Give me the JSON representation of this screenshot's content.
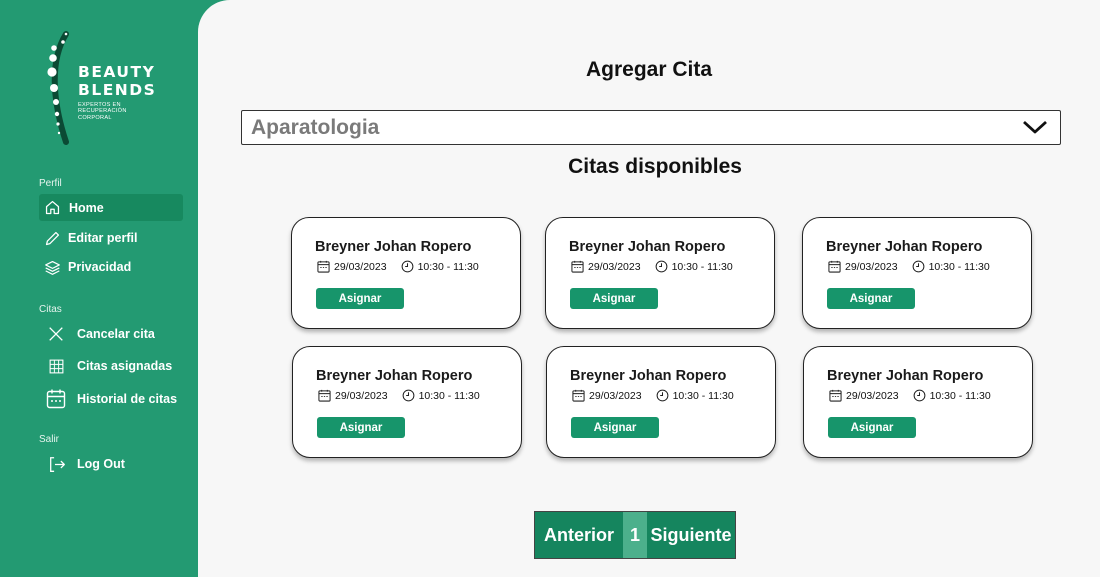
{
  "brand": {
    "name_line1": "BEAUTY",
    "name_line2": "BLENDS",
    "tagline_line1": "EXPERTOS EN",
    "tagline_line2": "RECUPERACIÓN",
    "tagline_line3": "CORPORAL"
  },
  "sidebar": {
    "section_profile": "Perfil",
    "home": "Home",
    "edit_profile": "Editar perfil",
    "privacy": "Privacidad",
    "section_appointments": "Citas",
    "cancel": "Cancelar cita",
    "assigned": "Citas asignadas",
    "history": "Historial de citas",
    "section_exit": "Salir",
    "logout": "Log Out"
  },
  "main": {
    "title": "Agregar Cita",
    "service_select_value": "Aparatologia",
    "subtitle": "Citas disponibles"
  },
  "cards": [
    {
      "name": "Breyner Johan Ropero",
      "date": "29/03/2023",
      "time": "10:30 - 11:30",
      "button": "Asignar"
    },
    {
      "name": "Breyner Johan Ropero",
      "date": "29/03/2023",
      "time": "10:30 - 11:30",
      "button": "Asignar"
    },
    {
      "name": "Breyner Johan Ropero",
      "date": "29/03/2023",
      "time": "10:30 - 11:30",
      "button": "Asignar"
    },
    {
      "name": "Breyner Johan Ropero",
      "date": "29/03/2023",
      "time": "10:30 - 11:30",
      "button": "Asignar"
    },
    {
      "name": "Breyner Johan Ropero",
      "date": "29/03/2023",
      "time": "10:30 - 11:30",
      "button": "Asignar"
    },
    {
      "name": "Breyner Johan Ropero",
      "date": "29/03/2023",
      "time": "10:30 - 11:30",
      "button": "Asignar"
    }
  ],
  "pagination": {
    "prev": "Anterior",
    "current": "1",
    "next": "Siguiente"
  },
  "colors": {
    "sidebar": "#239a72",
    "accent": "#17956b",
    "background": "#f7f7f7"
  }
}
